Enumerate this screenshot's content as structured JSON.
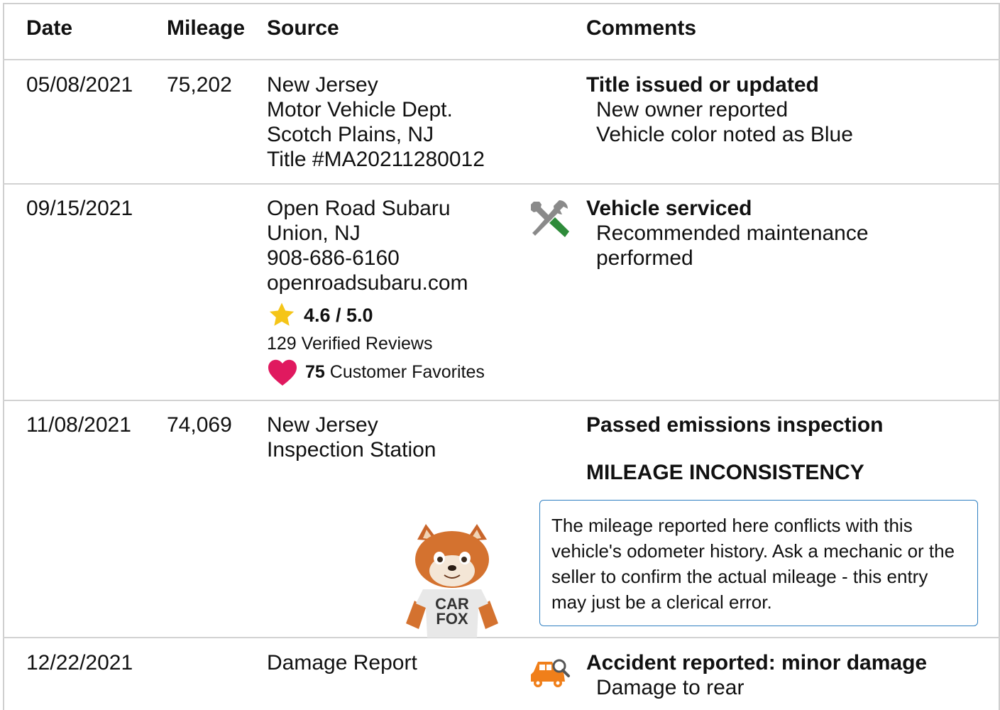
{
  "headers": {
    "date": "Date",
    "mileage": "Mileage",
    "source": "Source",
    "comments": "Comments"
  },
  "rows": [
    {
      "date": "05/08/2021",
      "mileage": "75,202",
      "source": [
        "New Jersey",
        "Motor Vehicle Dept.",
        "Scotch Plains, NJ",
        "Title #MA20211280012"
      ],
      "comment_title": "Title issued or updated",
      "comment_lines": [
        "New owner reported",
        "Vehicle color noted as Blue"
      ]
    },
    {
      "date": "09/15/2021",
      "mileage": "",
      "source": [
        "Open Road Subaru",
        "Union, NJ",
        "908-686-6160",
        "openroadsubaru.com"
      ],
      "rating": "4.6 / 5.0",
      "rating_value": 4.6,
      "reviews": "129 Verified Reviews",
      "favorites_count": "75",
      "favorites_label": "Customer Favorites",
      "icon": "wrench-screwdriver-icon",
      "comment_title": "Vehicle serviced",
      "comment_lines": [
        "Recommended maintenance",
        "performed"
      ]
    },
    {
      "date": "11/08/2021",
      "mileage": "74,069",
      "source": [
        "New Jersey",
        "Inspection Station"
      ],
      "comment_title": "Passed emissions inspection",
      "alert_title": "MILEAGE INCONSISTENCY",
      "alert_text": "The mileage reported here conflicts with this vehicle's odometer history. Ask a mechanic or the seller to confirm the actual mileage - this entry may just be a clerical error.",
      "mascot_shirt": [
        "CAR",
        "FOX"
      ]
    },
    {
      "date": "12/22/2021",
      "mileage": "",
      "source": [
        "Damage Report"
      ],
      "icon": "car-damage-search-icon",
      "comment_title": "Accident reported: minor damage",
      "comment_lines": [
        "Damage to rear"
      ]
    }
  ],
  "colors": {
    "star": "#f5c518",
    "heart": "#e0195f",
    "alert_border": "#2f7fc1",
    "wrench_gray": "#8a8a8a",
    "screwdriver_green": "#2e8b3a",
    "damage_orange": "#f07f1a"
  }
}
